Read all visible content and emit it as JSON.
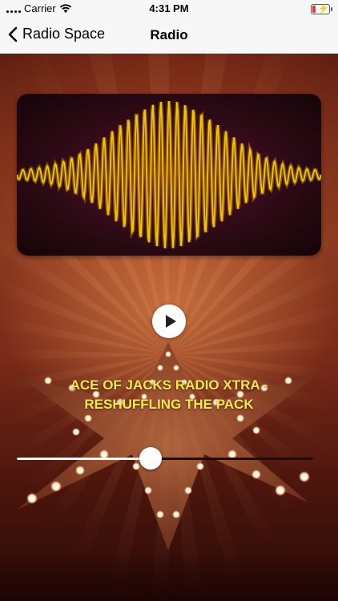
{
  "status_bar": {
    "carrier": "Carrier",
    "time": "4:31 PM",
    "battery_level": 0.15,
    "battery_charging": true
  },
  "nav": {
    "back_label": "Radio Space",
    "title": "Radio"
  },
  "player": {
    "play_icon": "play-icon",
    "track_title": "ACE OF JACKS RADIO XTRA - RESHUFFLING THE PACK",
    "progress": 0.45,
    "title_color": "#f5e94a",
    "wave_color": "#f5c400"
  }
}
